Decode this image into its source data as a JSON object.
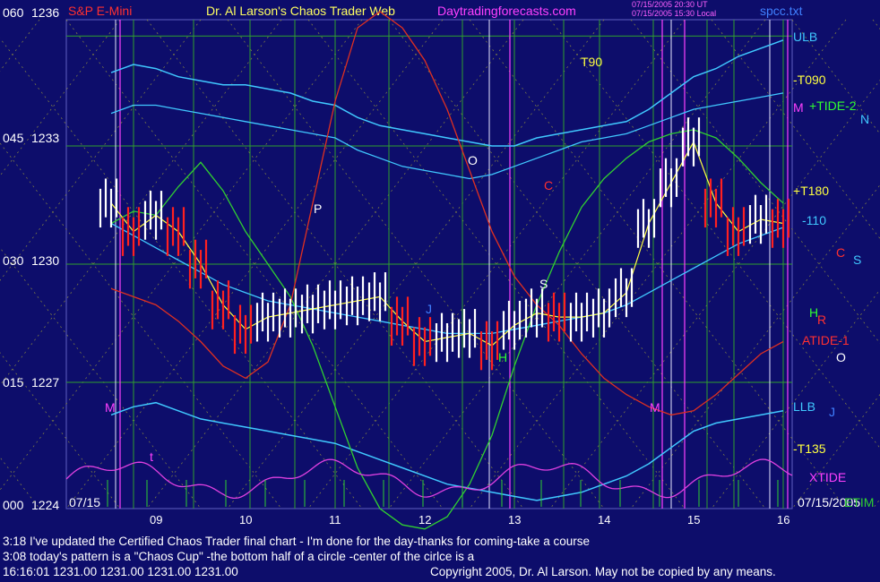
{
  "chart_data": {
    "type": "candlestick",
    "header": {
      "symbol": "S&P E-Mini",
      "title": "Dr. Al Larson's Chaos Trader Web",
      "site": "Daytradingforecasts.com",
      "stamp_1": "07/15/2005 20:30 UT",
      "stamp_2": "07/15/2005 15:30 Local",
      "file": "spcc.txt"
    },
    "y_axis": {
      "ticks": [
        {
          "code": "060",
          "price": 1236
        },
        {
          "code": "045",
          "price": 1233
        },
        {
          "code": "030",
          "price": 1230
        },
        {
          "code": "015",
          "price": 1227
        },
        {
          "code": "000",
          "price": 1224
        }
      ],
      "range": [
        1224,
        1236
      ]
    },
    "x_axis": {
      "start_label": "07/15",
      "end_label": "07/15/2005",
      "hours": [
        "09",
        "10",
        "11",
        "12",
        "13",
        "14",
        "15",
        "16"
      ],
      "range_hours": [
        8.0,
        16.1
      ]
    },
    "right_labels": {
      "ulb": "ULB",
      "t090_minus": "-T090",
      "tide2": "+TIDE-2",
      "m": "M",
      "n": "N",
      "t180": "+T180",
      "t110": "-110",
      "c": "C",
      "s": "S",
      "h": "H",
      "r": "R",
      "tide1": "ATIDE-1",
      "o": "O",
      "llb": "LLB",
      "j": "J",
      "t135": "-T135",
      "xtide": "XTIDE",
      "etim": "ETIM"
    },
    "chart_labels": {
      "t90": "T90",
      "o": "O",
      "c": "C",
      "p": "P",
      "j": "J",
      "s": "S",
      "h": "H",
      "m1": "M",
      "m2": "M",
      "t": "t"
    },
    "price_series": {
      "times": [
        8.5,
        8.75,
        9.0,
        9.25,
        9.5,
        9.75,
        10.0,
        10.25,
        10.5,
        10.75,
        11.0,
        11.25,
        11.5,
        11.75,
        12.0,
        12.25,
        12.5,
        12.75,
        13.0,
        13.25,
        13.5,
        13.75,
        14.0,
        14.25,
        14.5,
        14.75,
        15.0,
        15.25,
        15.5,
        15.75,
        16.0
      ],
      "close": [
        1231.5,
        1230.8,
        1231.2,
        1230.8,
        1230.0,
        1229.0,
        1228.4,
        1228.7,
        1228.8,
        1228.9,
        1229.0,
        1229.1,
        1229.2,
        1228.6,
        1228.1,
        1228.2,
        1228.3,
        1228.0,
        1228.5,
        1228.8,
        1228.7,
        1228.7,
        1228.8,
        1229.3,
        1231.0,
        1232.0,
        1233.0,
        1231.5,
        1230.8,
        1231.1,
        1231.0
      ]
    },
    "bands": {
      "ulb": [
        1234.7,
        1234.9,
        1234.8,
        1234.6,
        1234.5,
        1234.4,
        1234.4,
        1234.3,
        1234.2,
        1234.0,
        1233.9,
        1233.6,
        1233.4,
        1233.3,
        1233.2,
        1233.1,
        1233.0,
        1232.9,
        1232.9,
        1233.1,
        1233.2,
        1233.3,
        1233.4,
        1233.5,
        1233.8,
        1234.2,
        1234.6,
        1234.8,
        1235.1,
        1235.3,
        1235.5
      ],
      "mid_upper": [
        1233.7,
        1233.9,
        1233.9,
        1233.8,
        1233.7,
        1233.6,
        1233.5,
        1233.4,
        1233.3,
        1233.2,
        1233.1,
        1232.8,
        1232.6,
        1232.4,
        1232.3,
        1232.2,
        1232.1,
        1232.2,
        1232.4,
        1232.6,
        1232.8,
        1233.0,
        1233.1,
        1233.2,
        1233.4,
        1233.6,
        1233.8,
        1233.9,
        1234.0,
        1234.1,
        1234.2
      ],
      "llb": [
        1226.3,
        1226.5,
        1226.6,
        1226.4,
        1226.2,
        1226.1,
        1226.0,
        1225.9,
        1225.8,
        1225.7,
        1225.6,
        1225.4,
        1225.2,
        1225.0,
        1224.8,
        1224.6,
        1224.5,
        1224.4,
        1224.3,
        1224.2,
        1224.3,
        1224.4,
        1224.6,
        1224.8,
        1225.1,
        1225.5,
        1225.9,
        1226.1,
        1226.2,
        1226.3,
        1226.4
      ],
      "mid_lower": [
        1231.0,
        1230.7,
        1230.4,
        1230.1,
        1229.8,
        1229.5,
        1229.3,
        1229.1,
        1229.0,
        1228.9,
        1228.8,
        1228.7,
        1228.6,
        1228.5,
        1228.4,
        1228.3,
        1228.3,
        1228.3,
        1228.4,
        1228.5,
        1228.6,
        1228.7,
        1228.8,
        1229.0,
        1229.3,
        1229.6,
        1229.9,
        1230.2,
        1230.5,
        1230.7,
        1230.9
      ]
    },
    "green_osc": [
      1231.0,
      1231.3,
      1231.2,
      1231.9,
      1232.5,
      1231.8,
      1230.8,
      1230.0,
      1229.2,
      1228.0,
      1226.5,
      1225.0,
      1224.0,
      1223.6,
      1223.5,
      1223.8,
      1224.6,
      1225.8,
      1227.5,
      1229.0,
      1230.3,
      1231.4,
      1232.1,
      1232.6,
      1233.0,
      1233.2,
      1233.3,
      1233.1,
      1232.6,
      1232.0,
      1231.5
    ],
    "red_osc": [
      1229.4,
      1229.2,
      1229.0,
      1228.6,
      1228.1,
      1227.5,
      1227.2,
      1227.6,
      1229.0,
      1231.5,
      1234.0,
      1235.8,
      1236.2,
      1235.8,
      1235.0,
      1233.8,
      1232.3,
      1230.8,
      1229.7,
      1229.0,
      1228.5,
      1227.8,
      1227.2,
      1226.8,
      1226.5,
      1226.3,
      1226.4,
      1226.8,
      1227.3,
      1227.8,
      1228.1
    ],
    "vlines_green": [
      8.75,
      9.42,
      10.05,
      10.55,
      11.0,
      11.6,
      12.42,
      12.72,
      13.0,
      13.55,
      13.95,
      14.55,
      15.15,
      15.45,
      16.0
    ],
    "vlines_white": [
      8.55,
      12.72,
      14.75,
      15.85
    ],
    "vlines_magenta": [
      8.6,
      12.95,
      14.65,
      14.9,
      16.05
    ],
    "hlines_green": [
      1235.6,
      1232.9,
      1230.0,
      1227.1
    ],
    "bottom_text": {
      "line1": "3:18 I've updated the Certified Chaos Trader final chart - I'm done for the day-thanks for coming-take a course",
      "line2": "3:08 today's pattern is a \"Chaos Cup\" -the bottom half of a circle -center of the cirlce is a",
      "line3": "16:16:01   1231.00  1231.00  1231.00  1231.00",
      "copyright": "Copyright 2005, Dr. Al Larson. May not be copied by any means."
    }
  }
}
